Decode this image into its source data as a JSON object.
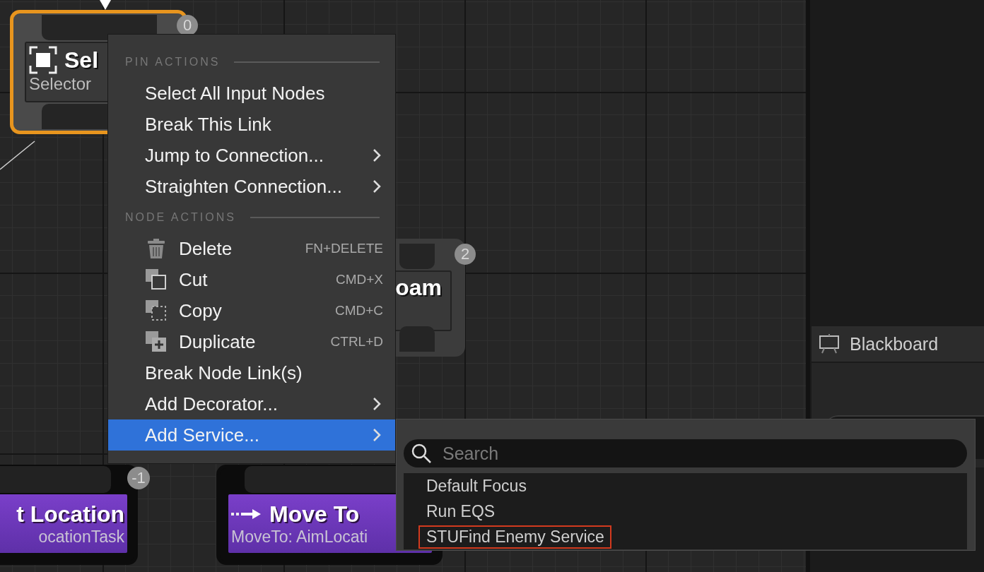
{
  "nodes": [
    {
      "kind": "composite",
      "title": "Sel",
      "subtitle": "Selector",
      "badge": "0",
      "selected": true
    },
    {
      "kind": "composite",
      "title": "oam",
      "badge": "2",
      "selected": false
    },
    {
      "kind": "task",
      "title": "t Location",
      "subtitle": "ocationTask",
      "badge": "-1",
      "selected": false
    },
    {
      "kind": "task",
      "title": "Move To",
      "subtitle": "MoveTo: AimLocati",
      "selected": false
    }
  ],
  "side_panel": {
    "title": "Blackboard"
  },
  "context_menu": {
    "sections": [
      {
        "heading": "PIN ACTIONS",
        "items": [
          {
            "kind": "plain",
            "label": "Select All Input Nodes",
            "selected": false
          },
          {
            "kind": "plain",
            "label": "Break This Link",
            "selected": false
          },
          {
            "kind": "submenu",
            "label": "Jump to Connection...",
            "selected": false
          },
          {
            "kind": "submenu",
            "label": "Straighten Connection...",
            "selected": false
          }
        ]
      },
      {
        "heading": "NODE ACTIONS",
        "items": [
          {
            "kind": "delete",
            "label": "Delete",
            "shortcut": "FN+DELETE",
            "selected": false
          },
          {
            "kind": "cut",
            "label": "Cut",
            "shortcut": "CMD+X",
            "selected": false
          },
          {
            "kind": "copy",
            "label": "Copy",
            "shortcut": "CMD+C",
            "selected": false
          },
          {
            "kind": "duplicate",
            "label": "Duplicate",
            "shortcut": "CTRL+D",
            "selected": false
          },
          {
            "kind": "plain",
            "label": "Break Node Link(s)",
            "selected": false
          },
          {
            "kind": "submenu",
            "label": "Add Decorator...",
            "selected": false
          },
          {
            "kind": "submenu",
            "label": "Add Service...",
            "selected": true
          }
        ]
      }
    ]
  },
  "submenu": {
    "search": {
      "placeholder": "Search"
    },
    "items": [
      {
        "label": "Default Focus",
        "outlined": false
      },
      {
        "label": "Run EQS",
        "outlined": false
      },
      {
        "label": "STUFind Enemy Service",
        "outlined": true
      }
    ]
  }
}
